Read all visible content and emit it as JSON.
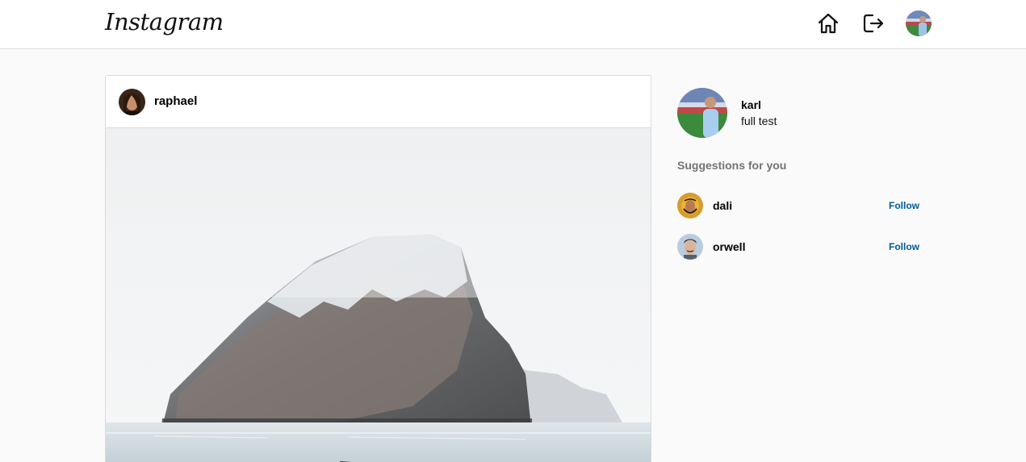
{
  "header": {
    "logo": "Instagram",
    "icons": [
      "home-icon",
      "logout-icon",
      "avatar"
    ]
  },
  "post": {
    "username": "raphael",
    "image": "misty snow-capped sea cliff island"
  },
  "profile": {
    "username": "karl",
    "full_name": "full test"
  },
  "suggestions": {
    "heading": "Suggestions for you",
    "items": [
      {
        "username": "dali",
        "action": "Follow"
      },
      {
        "username": "orwell",
        "action": "Follow"
      }
    ]
  },
  "colors": {
    "follow": "#005c98",
    "border": "#dbdbdb",
    "background": "#fafafa"
  }
}
